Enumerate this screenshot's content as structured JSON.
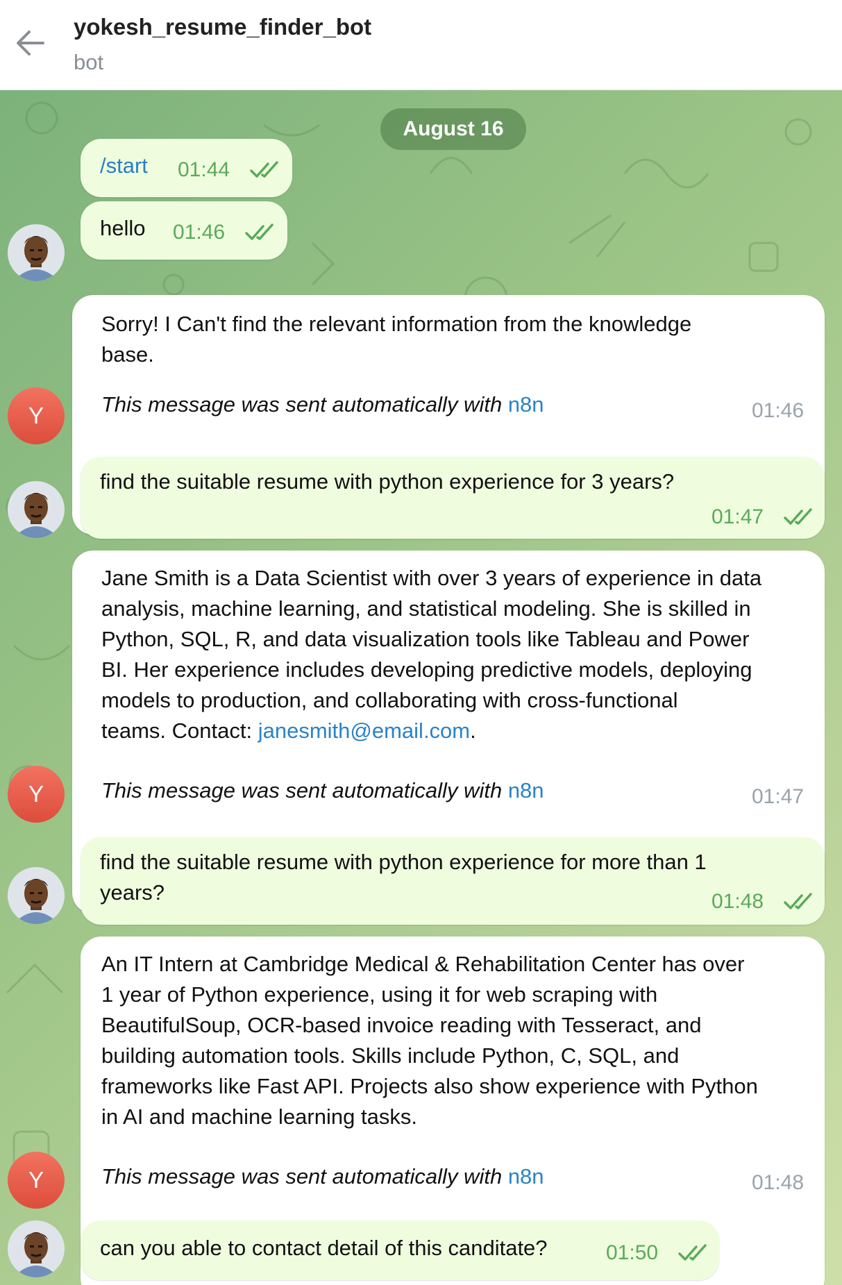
{
  "header": {
    "title": "yokesh_resume_finder_bot",
    "subtitle": "bot"
  },
  "chat": {
    "date": "August 16",
    "messages": [
      {
        "text": "/start",
        "time": "01:44"
      },
      {
        "text": "hello",
        "time": "01:46"
      },
      {
        "text_l1": "Sorry! I Can't find the relevant information from the knowledge",
        "text_l2": "base.",
        "auto_text": "This message was sent automatically with",
        "auto_link": "n8n",
        "time": "01:46",
        "avatar_letter": "Y"
      },
      {
        "text": "find the suitable resume with python experience for 3 years?",
        "time": "01:47"
      },
      {
        "lines": [
          "Jane Smith is a Data Scientist with over 3 years of experience in data",
          "analysis, machine learning, and statistical modeling. She is skilled in",
          "Python, SQL, R, and data visualization tools like Tableau and Power",
          "BI. Her experience includes developing predictive models, deploying",
          "models to production, and collaborating with cross-functional"
        ],
        "last_line_prefix": "teams. Contact: ",
        "email": "janesmith@email.com",
        "last_line_suffix": ".",
        "auto_text": "This message was sent automatically with",
        "auto_link": "n8n",
        "time": "01:47",
        "avatar_letter": "Y"
      },
      {
        "text_l1": "find the suitable resume with python experience for more than 1",
        "text_l2": "years?",
        "time": "01:48"
      },
      {
        "lines": [
          "An IT Intern at Cambridge Medical & Rehabilitation Center has over",
          "1 year of Python experience, using it for web scraping with",
          "BeautifulSoup, OCR-based invoice reading with Tesseract, and",
          "building automation tools. Skills include Python, C, SQL, and",
          "frameworks like Fast API. Projects also show experience with Python",
          "in AI and machine learning tasks."
        ],
        "auto_text": "This message was sent automatically with",
        "auto_link": "n8n",
        "time": "01:48",
        "avatar_letter": "Y"
      },
      {
        "text": "can you able to contact detail of this canditate?",
        "time": "01:50"
      }
    ]
  },
  "colors": {
    "outgoing_bubble": "#effdde",
    "incoming_bubble": "#ffffff",
    "link": "#2a82c8",
    "outgoing_time": "#5aaa5a",
    "chat_background": "#9cc487",
    "bot_avatar": "#e85c4a"
  },
  "icons": {
    "back": "arrow-left-icon",
    "read_status": "double-check-icon",
    "user_avatar": "user-photo",
    "bot_avatar": "letter-avatar"
  }
}
